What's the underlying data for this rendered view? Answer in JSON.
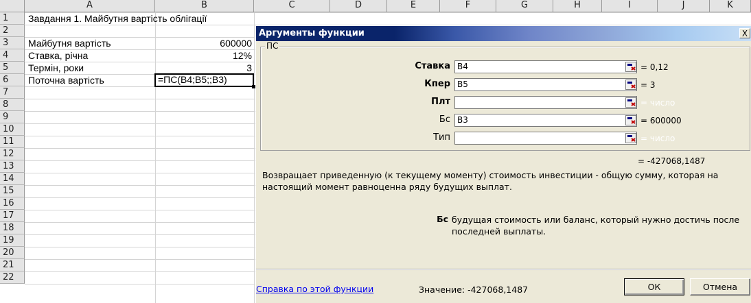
{
  "sheet": {
    "columns": [
      "A",
      "B",
      "C",
      "D",
      "E",
      "F",
      "G",
      "H",
      "I",
      "J",
      "K"
    ],
    "rows": [
      "1",
      "2",
      "3",
      "4",
      "5",
      "6",
      "7",
      "8",
      "9",
      "10",
      "11",
      "12",
      "13",
      "14",
      "15",
      "16",
      "17",
      "18",
      "19",
      "20",
      "21",
      "22"
    ],
    "cells": {
      "a1": "Завдання 1. Майбутня вартість облігації",
      "a3": "Майбутня вартість",
      "b3": "600000",
      "a4": "Ставка, річна",
      "b4": "12%",
      "a5": "Термін, роки",
      "b5": "3",
      "a6": "Поточна вартість",
      "b6": "=ПС(B4;B5;;B3)"
    }
  },
  "dialog": {
    "title": "Аргументы функции",
    "close": "X",
    "function_name": "ПС",
    "args": [
      {
        "label": "Ставка",
        "value": "B4",
        "result": "= 0,12"
      },
      {
        "label": "Кпер",
        "value": "B5",
        "result": "= 3"
      },
      {
        "label": "Плт",
        "value": "",
        "result": "= число"
      },
      {
        "label": "Бс",
        "value": "B3",
        "result": "= 600000"
      },
      {
        "label": "Тип",
        "value": "",
        "result": "= число"
      }
    ],
    "result": "= -427068,1487",
    "description": "Возвращает приведенную (к текущему моменту) стоимость инвестиции - общую сумму, которая на настоящий момент равноценна ряду будущих выплат.",
    "arg_help_name": "Бс",
    "arg_help_text": "будущая стоимость или баланс, который нужно достичь после последней выплаты.",
    "help_link": "Справка по этой функции",
    "value_text": "Значение: -427068,1487",
    "ok": "ОК",
    "cancel": "Отмена"
  }
}
